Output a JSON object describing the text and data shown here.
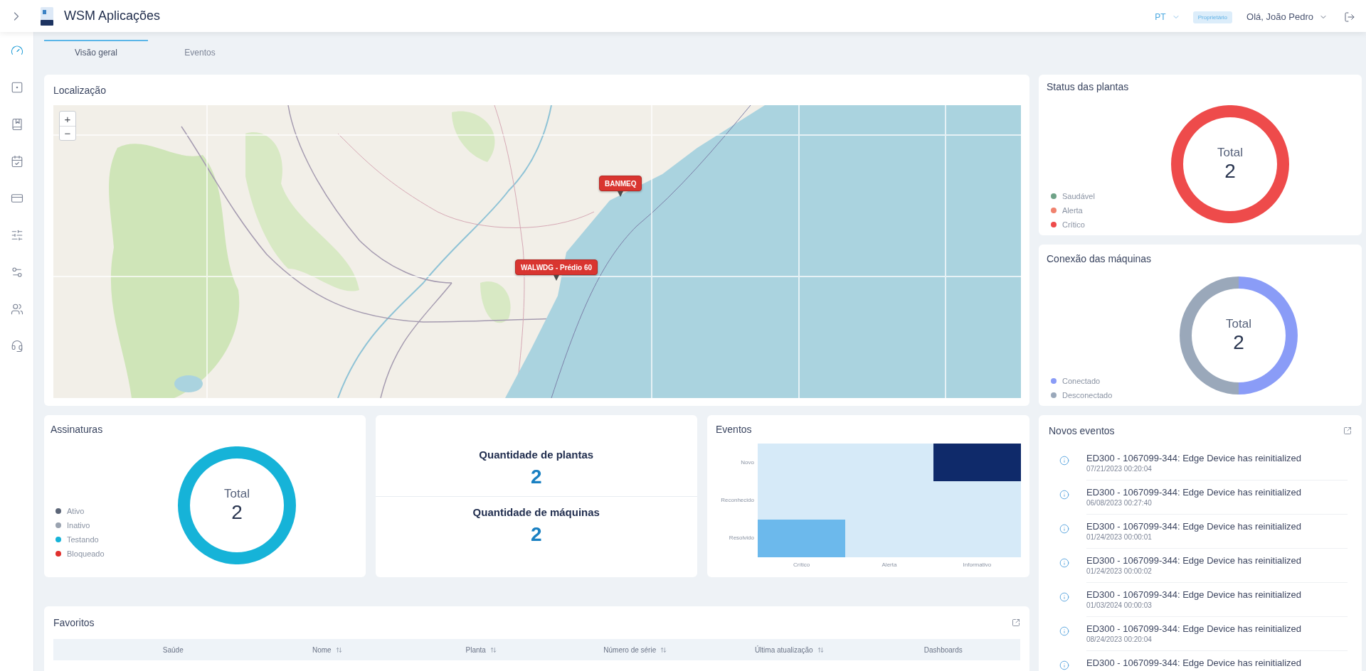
{
  "sidebar": {
    "items": [
      {
        "selected": true
      },
      {
        "selected": false
      },
      {
        "selected": false
      },
      {
        "selected": false
      },
      {
        "selected": false
      },
      {
        "selected": false
      },
      {
        "selected": false
      },
      {
        "selected": false
      },
      {
        "selected": false
      }
    ]
  },
  "header": {
    "title": "WSM Aplicações",
    "language": "PT",
    "role_badge": "Proprietário",
    "user": "Olá, João Pedro"
  },
  "tabs": [
    {
      "label": "Visão geral",
      "selected": true
    },
    {
      "label": "Eventos",
      "selected": false
    }
  ],
  "location": {
    "title": "Localização",
    "zoom_buttons": [
      "+",
      "−"
    ],
    "markers": [
      "BANMEQ",
      "WALWDG - Prédio 60"
    ]
  },
  "plant_status": {
    "title": "Status das plantas",
    "total_label": "Total",
    "total": "2",
    "legend": [
      {
        "label": "Saudável",
        "color": "#6fa287"
      },
      {
        "label": "Alerta",
        "color": "#f0826e"
      },
      {
        "label": "Crítico",
        "color": "#ee4b4b"
      }
    ]
  },
  "machine_connection": {
    "title": "Conexão das máquinas",
    "total_label": "Total",
    "total": "2",
    "legend": [
      {
        "label": "Conectado",
        "color": "#8a9cf7"
      },
      {
        "label": "Desconectado",
        "color": "#9aa8ba"
      }
    ]
  },
  "subscriptions": {
    "title": "Assinaturas",
    "total_label": "Total",
    "total": "2",
    "legend": [
      {
        "label": "Ativo",
        "color": "#5b6577"
      },
      {
        "label": "Inativo",
        "color": "#9aa3b0"
      },
      {
        "label": "Testando",
        "color": "#16b3d8"
      },
      {
        "label": "Bloqueado",
        "color": "#e0302e"
      }
    ]
  },
  "counts": [
    {
      "label": "Quantidade de plantas",
      "value": "2"
    },
    {
      "label": "Quantidade de máquinas",
      "value": "2"
    }
  ],
  "events": {
    "title": "Eventos",
    "row_labels": [
      "Novo",
      "Reconhecido",
      "Resolvido"
    ],
    "column_labels": [
      "Crítico",
      "Alerta",
      "Informativo"
    ],
    "cells": [
      [
        {
          "color": "#d6eaf8"
        },
        {
          "color": "#d6eaf8"
        },
        {
          "color": "#0f2a6a"
        }
      ],
      [
        {
          "color": "#d6eaf8"
        },
        {
          "color": "#d6eaf8"
        },
        {
          "color": "#d6eaf8"
        }
      ],
      [
        {
          "color": "#6cb9ec"
        },
        {
          "color": "#d6eaf8"
        },
        {
          "color": "#d6eaf8"
        }
      ]
    ]
  },
  "new_events": {
    "title": "Novos eventos",
    "items": [
      {
        "title": "ED300 - 1067099-344: Edge Device has reinitialized",
        "time": "07/21/2023 00:20:04"
      },
      {
        "title": "ED300 - 1067099-344: Edge Device has reinitialized",
        "time": "06/08/2023 00:27:40"
      },
      {
        "title": "ED300 - 1067099-344: Edge Device has reinitialized",
        "time": "01/24/2023 00:00:01"
      },
      {
        "title": "ED300 - 1067099-344: Edge Device has reinitialized",
        "time": "01/24/2023 00:00:02"
      },
      {
        "title": "ED300 - 1067099-344: Edge Device has reinitialized",
        "time": "01/03/2024 00:00:03"
      },
      {
        "title": "ED300 - 1067099-344: Edge Device has reinitialized",
        "time": "08/24/2023 00:20:04"
      },
      {
        "title": "ED300 - 1067099-344: Edge Device has reinitialized"
      }
    ]
  },
  "favorites": {
    "title": "Favoritos",
    "columns": [
      {
        "label": "Saúde",
        "sortable": false
      },
      {
        "label": "Nome",
        "sortable": true
      },
      {
        "label": "Planta",
        "sortable": true
      },
      {
        "label": "Número de série",
        "sortable": true
      },
      {
        "label": "Última atualização",
        "sortable": true
      },
      {
        "label": "Dashboards",
        "sortable": false
      }
    ]
  }
}
